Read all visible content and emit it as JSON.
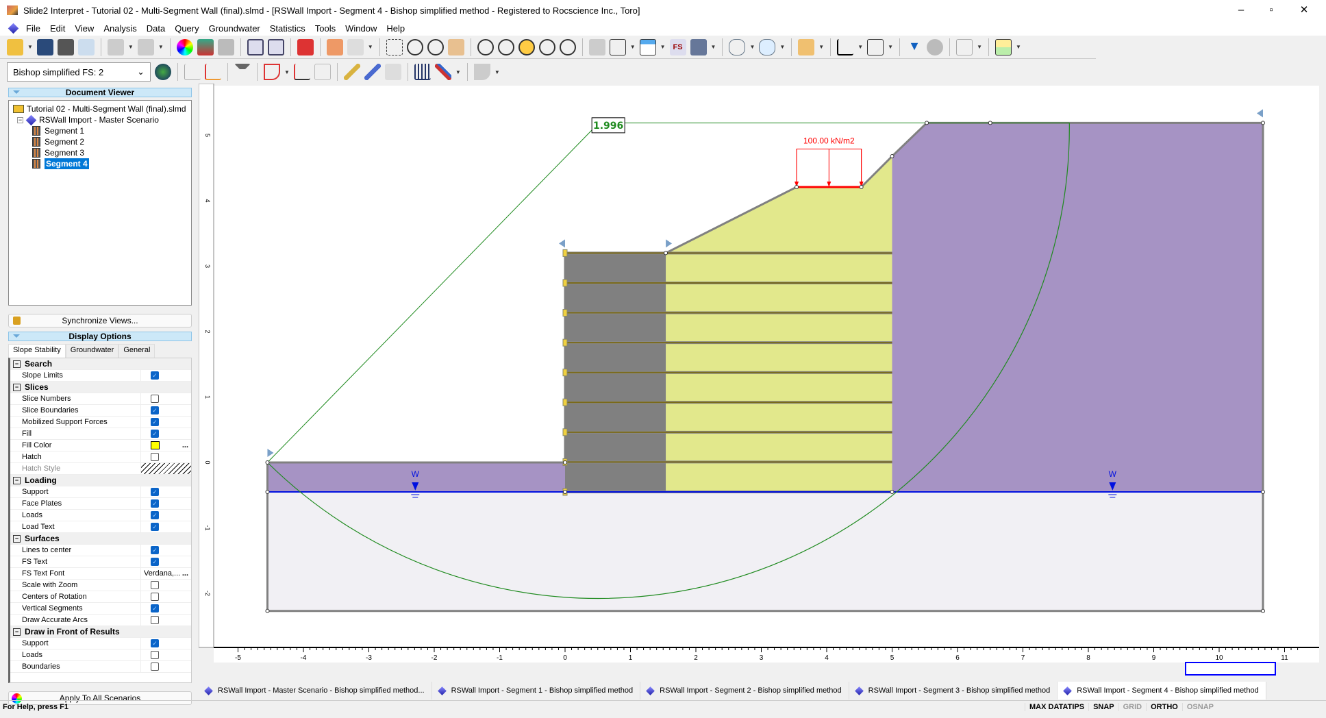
{
  "window": {
    "title": "Slide2 Interpret - Tutorial 02 - Multi-Segment Wall (final).slmd - [RSWall Import - Segment 4 - Bishop simplified method - Registered to Rocscience Inc., Toro]"
  },
  "menu": [
    "File",
    "Edit",
    "View",
    "Analysis",
    "Data",
    "Query",
    "Groundwater",
    "Statistics",
    "Tools",
    "Window",
    "Help"
  ],
  "toolbar": {
    "fs_combo": "Bishop simplified FS:  2"
  },
  "document_viewer": {
    "header": "Document Viewer",
    "file": "Tutorial 02 - Multi-Segment Wall (final).slmd",
    "scenario": "RSWall Import - Master Scenario",
    "segments": [
      "Segment 1",
      "Segment 2",
      "Segment 3",
      "Segment 4"
    ],
    "selected": "Segment 4"
  },
  "sync_button": "Synchronize Views...",
  "display_options": {
    "header": "Display Options",
    "tabs": [
      "Slope Stability",
      "Groundwater",
      "General"
    ],
    "groups": [
      {
        "name": "Search",
        "rows": [
          {
            "label": "Slope Limits",
            "checked": true
          }
        ]
      },
      {
        "name": "Slices",
        "rows": [
          {
            "label": "Slice Numbers",
            "checked": false
          },
          {
            "label": "Slice Boundaries",
            "checked": true
          },
          {
            "label": "Mobilized Support Forces",
            "checked": true
          },
          {
            "label": "Fill",
            "checked": true
          },
          {
            "label": "Fill Color",
            "color": "#ffff00"
          },
          {
            "label": "Hatch",
            "checked": false
          },
          {
            "label": "Hatch Style",
            "hatch": true
          }
        ]
      },
      {
        "name": "Loading",
        "rows": [
          {
            "label": "Support",
            "checked": true
          },
          {
            "label": "Face Plates",
            "checked": true
          },
          {
            "label": "Loads",
            "checked": true
          },
          {
            "label": "Load Text",
            "checked": true
          }
        ]
      },
      {
        "name": "Surfaces",
        "rows": [
          {
            "label": "Lines to center",
            "checked": true
          },
          {
            "label": "FS Text",
            "checked": true
          },
          {
            "label": "FS Text Font",
            "text": "Verdana,..."
          },
          {
            "label": "Scale with Zoom",
            "checked": false
          },
          {
            "label": "Centers of Rotation",
            "checked": false
          },
          {
            "label": "Vertical Segments",
            "checked": true
          },
          {
            "label": "Draw Accurate Arcs",
            "checked": false
          }
        ]
      },
      {
        "name": "Draw in Front of Results",
        "rows": [
          {
            "label": "Support",
            "checked": true
          },
          {
            "label": "Loads",
            "checked": false
          },
          {
            "label": "Boundaries",
            "checked": false
          }
        ]
      }
    ]
  },
  "apply_button": "Apply To All Scenarios",
  "model": {
    "fs_label": "1.996",
    "load_label": "100.00 kN/m2",
    "water_label": "W",
    "x_ticks": [
      -5,
      -4,
      -3,
      -2,
      -1,
      0,
      1,
      2,
      3,
      4,
      5,
      6,
      7,
      8,
      9,
      10,
      11
    ],
    "y_ticks": [
      -2,
      -1,
      0,
      1,
      2,
      3,
      4,
      5
    ],
    "colors": {
      "purple": "#a693c4",
      "yellow": "#e2e88c",
      "facing": "#808080",
      "foundation": "#f1f0f4",
      "slip": "#1e8a1e",
      "water": "#0010e0",
      "load": "#ff0000",
      "reinforcement": "#7a6a1a"
    },
    "slip_center": [
      0.48,
      5.15
    ],
    "slip_radius": 7.2,
    "slip_ends": [
      [
        -4.55,
        0
      ],
      [
        7.71,
        5.19
      ]
    ],
    "fs_point": [
      0.41,
      5.08
    ],
    "load_x": [
      3.54,
      4.53
    ],
    "load_y": 4.21,
    "load_top": 4.79,
    "water_markers_x": [
      -2.29,
      8.37
    ],
    "water_y": -0.45,
    "reinforcement_y": [
      -0.45,
      0.006,
      0.4625,
      0.919,
      1.375,
      1.831,
      2.2875,
      2.744,
      3.2
    ],
    "wall_x": [
      0,
      5
    ],
    "facing_x": [
      0,
      1.54
    ],
    "purple_right": [
      [
        5,
        -0.45
      ],
      [
        5,
        4.68
      ],
      [
        5.53,
        5.19
      ],
      [
        10.67,
        5.19
      ],
      [
        10.67,
        -0.45
      ]
    ],
    "purple_left": [
      [
        -4.55,
        0
      ],
      [
        0,
        0
      ],
      [
        0,
        -0.45
      ],
      [
        -4.55,
        -0.45
      ]
    ],
    "foundation": [
      [
        -4.55,
        -0.45
      ],
      [
        10.67,
        -0.45
      ],
      [
        10.67,
        -2.27
      ],
      [
        -4.55,
        -2.27
      ]
    ],
    "yellow": [
      [
        1.54,
        -0.45
      ],
      [
        1.54,
        3.2
      ],
      [
        3.54,
        4.21
      ],
      [
        4.53,
        4.21
      ],
      [
        5,
        4.68
      ],
      [
        5,
        -0.45
      ]
    ],
    "facing": [
      [
        0,
        -0.45
      ],
      [
        0,
        3.2
      ],
      [
        1.54,
        3.2
      ],
      [
        1.54,
        -0.45
      ]
    ],
    "boundary": [
      [
        -4.55,
        0
      ],
      [
        0,
        0
      ],
      [
        0,
        3.2
      ],
      [
        1.54,
        3.2
      ],
      [
        3.54,
        4.21
      ],
      [
        4.53,
        4.21
      ],
      [
        5,
        4.68
      ],
      [
        5.53,
        5.19
      ],
      [
        10.67,
        5.19
      ],
      [
        10.67,
        -2.27
      ],
      [
        -4.55,
        -2.27
      ],
      [
        -4.55,
        0
      ]
    ],
    "vertices": [
      [
        -4.55,
        0
      ],
      [
        0,
        0
      ],
      [
        1.54,
        3.2
      ],
      [
        3.54,
        4.21
      ],
      [
        4.53,
        4.21
      ],
      [
        5,
        4.68
      ],
      [
        5.53,
        5.19
      ],
      [
        6.5,
        5.19
      ],
      [
        10.67,
        5.19
      ],
      [
        10.67,
        -0.45
      ],
      [
        10.67,
        -2.27
      ],
      [
        -4.55,
        -2.27
      ],
      [
        -4.55,
        -0.45
      ],
      [
        0,
        -0.45
      ],
      [
        5,
        -0.45
      ]
    ]
  },
  "doc_tabs": [
    "RSWall Import - Master Scenario - Bishop simplified method...",
    "RSWall Import - Segment 1 - Bishop simplified method",
    "RSWall Import - Segment 2 - Bishop simplified method",
    "RSWall Import - Segment 3 - Bishop simplified method",
    "RSWall Import - Segment 4 - Bishop simplified method"
  ],
  "status": {
    "help": "For Help, press F1",
    "indicators": [
      {
        "label": "MAX DATATIPS",
        "on": true
      },
      {
        "label": "SNAP",
        "on": true
      },
      {
        "label": "GRID",
        "on": false
      },
      {
        "label": "ORTHO",
        "on": true
      },
      {
        "label": "OSNAP",
        "on": false
      }
    ]
  }
}
